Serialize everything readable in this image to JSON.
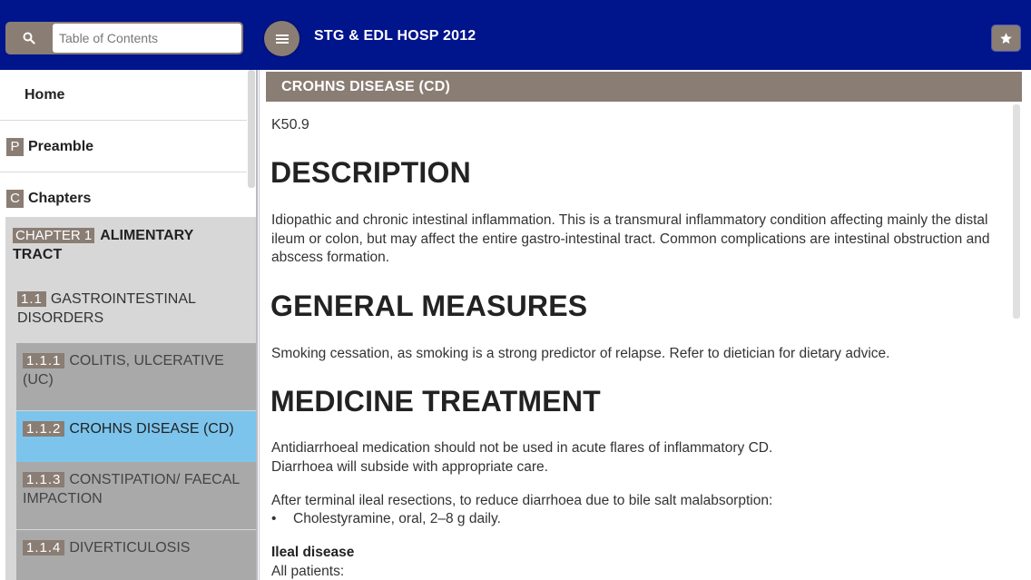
{
  "header": {
    "search_placeholder": "Table of Contents",
    "title": "STG & EDL HOSP 2012"
  },
  "sidebar": {
    "home": "Home",
    "preamble_badge": "P",
    "preamble": "Preamble",
    "chapters_badge": "C",
    "chapters": "Chapters",
    "chapter": {
      "badge": "CHAPTER 1",
      "name": "ALIMENTARY TRACT"
    },
    "section": {
      "badge": "1.1",
      "name": "GASTROINTESTINAL DISORDERS"
    },
    "subsections": [
      {
        "badge": "1.1.1",
        "name": "COLITIS, ULCERATIVE (UC)",
        "selected": false
      },
      {
        "badge": "1.1.2",
        "name": "CROHNS DISEASE (CD)",
        "selected": true
      },
      {
        "badge": "1.1.3",
        "name": "CONSTIPATION/ FAECAL IMPACTION",
        "selected": false
      },
      {
        "badge": "1.1.4",
        "name": "DIVERTICULOSIS",
        "selected": false
      }
    ]
  },
  "content": {
    "section_title": "CROHNS DISEASE (CD)",
    "code": "K50.9",
    "description_heading": "DESCRIPTION",
    "description_text": "Idiopathic and chronic intestinal inflammation. This is a transmural inflammatory condition affecting mainly the distal ileum or colon, but may affect the entire gastro-intestinal tract. Common complications are intestinal obstruction and abscess formation.",
    "general_heading": "GENERAL MEASURES",
    "general_text": "Smoking cessation, as smoking is a strong predictor of relapse. Refer to dietician for dietary advice.",
    "medicine_heading": "MEDICINE TREATMENT",
    "medicine_line1": "Antidiarrhoeal medication should not be used in acute flares of inflammatory CD.",
    "medicine_line2": "Diarrhoea will subside with appropriate care.",
    "medicine_para2": "After terminal ileal resections, to reduce diarrhoea due to bile salt malabsorption:",
    "bullet_symbol": "•",
    "bullet_item": "Cholestyramine, oral, 2–8 g daily.",
    "ileal_heading": "Ileal disease",
    "all_patients": "All patients:"
  },
  "colors": {
    "topbar": "#00148c",
    "badge": "#8a7d74",
    "selected": "#7cc4ec",
    "sub_item": "#a9a9a9",
    "chapter_block": "#d7d7d7"
  },
  "icons": [
    "search-icon",
    "menu-icon",
    "star-icon"
  ]
}
